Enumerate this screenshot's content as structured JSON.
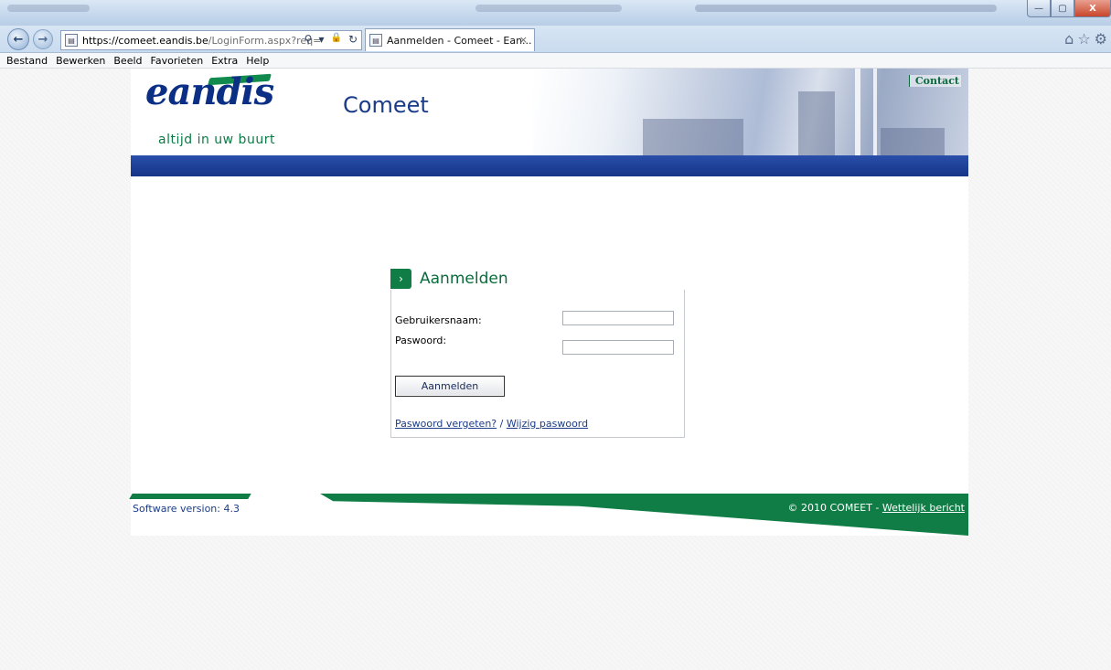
{
  "browser": {
    "url_host": "https://comeet.eandis.be",
    "url_path": "/LoginForm.aspx?req=",
    "tab_title": "Aanmelden - Comeet - Ean...",
    "tab_close": "×",
    "back_glyph": "←",
    "forward_glyph": "→",
    "search_glyph": "⚲",
    "dropdown_glyph": "▾",
    "lock_glyph": "🔒",
    "refresh_glyph": "↻",
    "home_glyph": "⌂",
    "favorites_glyph": "☆",
    "settings_glyph": "⚙",
    "minimize_glyph": "—",
    "maximize_glyph": "▢",
    "close_glyph": "X"
  },
  "menu": {
    "items": [
      "Bestand",
      "Bewerken",
      "Beeld",
      "Favorieten",
      "Extra",
      "Help"
    ]
  },
  "header": {
    "logo": "eandis",
    "tagline": "altijd in uw buurt",
    "site_title": "Comeet",
    "contact_link": "Contact"
  },
  "login": {
    "arrow_glyph": "›",
    "title": "Aanmelden",
    "username_label": "Gebruikersnaam:",
    "username_value": "",
    "password_label": "Paswoord:",
    "password_value": "",
    "submit_label": "Aanmelden",
    "forgot_link": "Paswoord vergeten?",
    "separator": " / ",
    "change_link": "Wijzig paswoord"
  },
  "footer": {
    "version": "Software version: 4.3",
    "copyright": "© 2010 COMEET - ",
    "legal_link": "Wettelijk bericht"
  },
  "colors": {
    "brand_green": "#0f7d45",
    "brand_blue": "#143487",
    "link_blue": "#1a3c88"
  }
}
